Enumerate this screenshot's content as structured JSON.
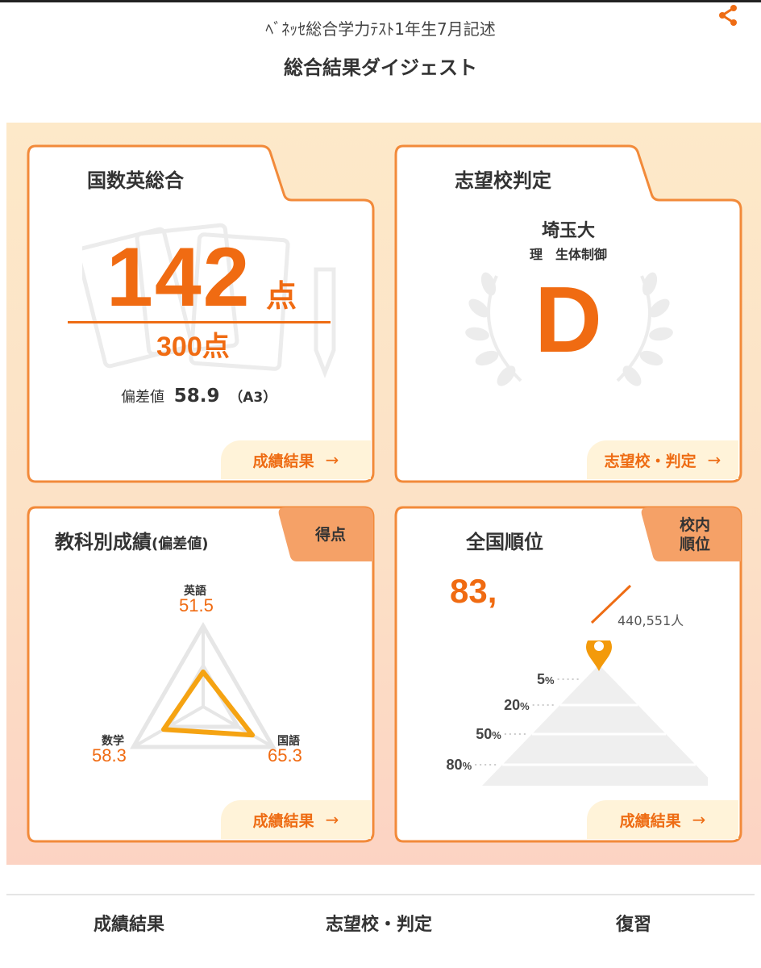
{
  "header": {
    "subtitle": "ﾍﾞﾈｯｾ総合学力ﾃｽﾄ1年生7月記述",
    "title": "総合結果ダイジェスト",
    "share_icon": "share-icon"
  },
  "colors": {
    "accent": "#f06b12",
    "card_border": "#f28a3a",
    "tab_fill": "#f5a167",
    "link_bg": "#fff3d9",
    "panel_bg": "#fde9c9"
  },
  "total_card": {
    "title": "国数英総合",
    "score": "142",
    "score_unit": "点",
    "max_score": "300点",
    "deviation_label": "偏差値",
    "deviation_value": "58.9",
    "rank_code": "（A3）",
    "link_label": "成績結果",
    "link_arrow": "→"
  },
  "school_card": {
    "title": "志望校判定",
    "school_name": "埼玉大",
    "department": "理　生体制御",
    "grade": "D",
    "link_label": "志望校・判定",
    "link_arrow": "→"
  },
  "subject_card": {
    "title": "教科別成績",
    "title_suffix": "(偏差値)",
    "tab_label": "得点",
    "link_label": "成績結果",
    "link_arrow": "→",
    "subjects": [
      {
        "name": "英語",
        "value": "51.5"
      },
      {
        "name": "数学",
        "value": "58.3"
      },
      {
        "name": "国語",
        "value": "65.3"
      }
    ]
  },
  "chart_data": {
    "type": "radar",
    "categories": [
      "英語",
      "国語",
      "数学"
    ],
    "values": [
      51.5,
      65.3,
      58.3
    ]
  },
  "rank_card": {
    "title": "全国順位",
    "tab_label": "校内\n順位",
    "rank_value": "83,",
    "rank_total": "440,551人",
    "link_label": "成績結果",
    "link_arrow": "→",
    "pyramid_levels": [
      "5%",
      "20%",
      "50%",
      "80%"
    ],
    "marker_level_percent": 5
  },
  "bottom_nav": {
    "results": "成績結果",
    "school": "志望校・判定",
    "review": "復習"
  }
}
